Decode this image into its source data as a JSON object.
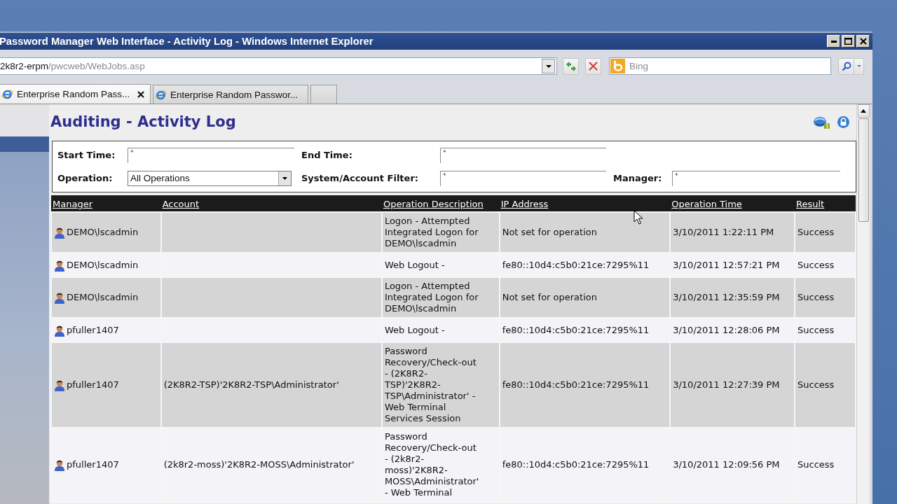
{
  "window": {
    "title": "Password Manager Web Interface - Activity Log - Windows Internet Explorer"
  },
  "address_bar": {
    "host": "2k8r2-erpm",
    "path": "/pwcweb/WebJobs.asp"
  },
  "search": {
    "placeholder": "Bing"
  },
  "tabs": [
    {
      "kind": "page",
      "label": "Enterprise Random Pass...",
      "selected": true
    },
    {
      "kind": "page",
      "label": "Enterprise Random Passwor...",
      "selected": false
    },
    {
      "kind": "new",
      "selected": false
    }
  ],
  "page": {
    "title": "Auditing - Activity Log"
  },
  "filter_rows": [
    {
      "fields": [
        {
          "kind": "text",
          "label": "Start Time:",
          "value": "*"
        },
        {
          "kind": "text",
          "label": "End Time:",
          "value": "*"
        }
      ]
    },
    {
      "fields": [
        {
          "kind": "select",
          "label": "Operation:",
          "value": "All Operations"
        },
        {
          "kind": "text",
          "label": "System/Account Filter:",
          "value": "*"
        },
        {
          "kind": "text",
          "label": "Manager:",
          "value": "*"
        }
      ]
    }
  ],
  "table": {
    "columns": [
      "Manager",
      "Account",
      "Operation Description",
      "IP Address",
      "Operation Time",
      "Result"
    ],
    "rows": [
      {
        "manager": "DEMO\\lscadmin",
        "operation": "Logon - Attempted Integrated Logon for DEMO\\lscadmin",
        "ip": "Not set for operation",
        "time": "3/10/2011 1:22:11 PM",
        "result": "Success"
      },
      {
        "manager": "DEMO\\lscadmin",
        "operation": "Web Logout -",
        "ip": "fe80::10d4:c5b0:21ce:7295%11",
        "time": "3/10/2011 12:57:21 PM",
        "result": "Success"
      },
      {
        "manager": "DEMO\\lscadmin",
        "operation": "Logon - Attempted Integrated Logon for DEMO\\lscadmin",
        "ip": "Not set for operation",
        "time": "3/10/2011 12:35:59 PM",
        "result": "Success"
      },
      {
        "manager": "pfuller1407",
        "operation": "Web Logout -",
        "ip": "fe80::10d4:c5b0:21ce:7295%11",
        "time": "3/10/2011 12:28:06 PM",
        "result": "Success"
      },
      {
        "manager": "pfuller1407",
        "account": "(2K8R2-TSP)'2K8R2-TSP\\Administrator'",
        "operation": "Password Recovery/Check-out - (2K8R2-TSP)'2K8R2-TSP\\Administrator' - Web Terminal Services Session",
        "ip": "fe80::10d4:c5b0:21ce:7295%11",
        "time": "3/10/2011 12:27:39 PM",
        "result": "Success"
      },
      {
        "manager": "pfuller1407",
        "account": "(2k8r2-moss)'2K8R2-MOSS\\Administrator'",
        "operation": "Password Recovery/Check-out - (2k8r2-moss)'2K8R2-MOSS\\Administrator' - Web Terminal",
        "ip": "fe80::10d4:c5b0:21ce:7295%11",
        "time": "3/10/2011 12:09:56 PM",
        "result": "Success"
      }
    ]
  }
}
